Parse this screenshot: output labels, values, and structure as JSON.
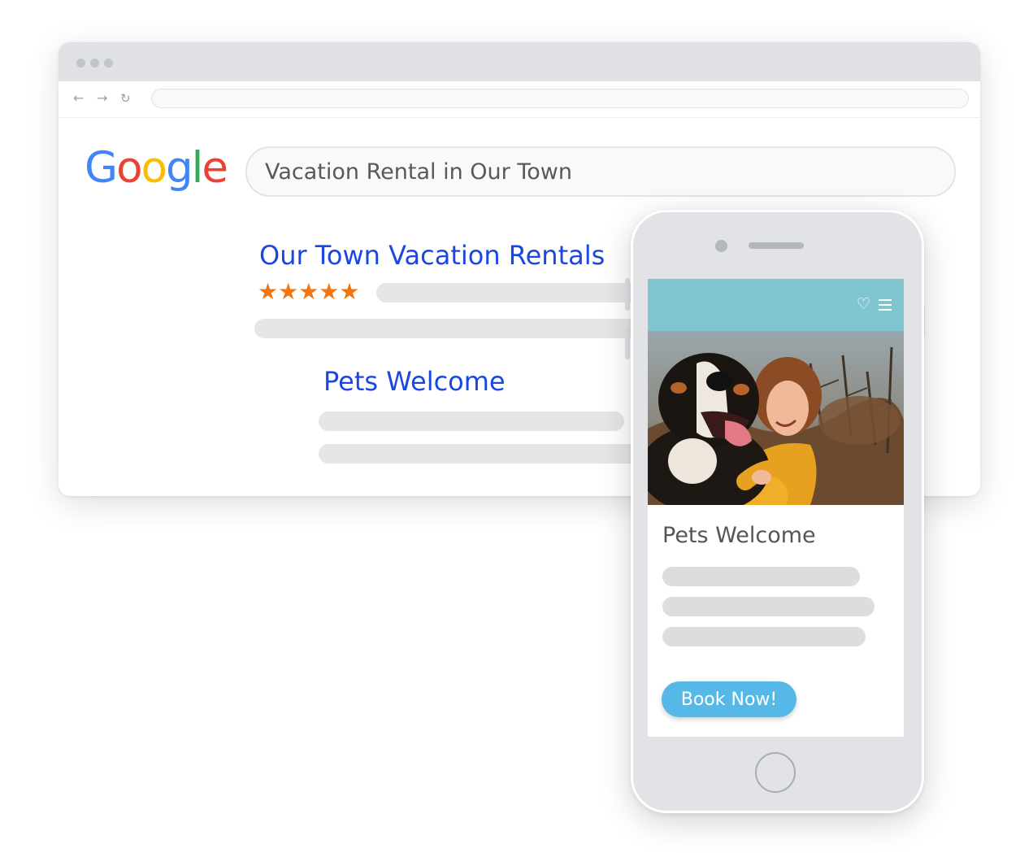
{
  "search": {
    "logo_letters": [
      "G",
      "o",
      "o",
      "g",
      "l",
      "e"
    ],
    "query": "Vacation Rental in Our Town"
  },
  "results": [
    {
      "title": "Our Town Vacation Rentals",
      "rating": 5,
      "stars": "★★★★★"
    },
    {
      "title": "Pets Welcome"
    }
  ],
  "mobile": {
    "title": "Pets Welcome",
    "book_label": "Book Now!",
    "heart_glyph": "♡"
  },
  "colors": {
    "result_link": "#1a47e0",
    "stars": "#f27510",
    "app_bar": "#7fc6d1",
    "book_button": "#56b8e6",
    "google_blue": "#4285f4",
    "google_red": "#ea4335",
    "google_yellow": "#fbbc05",
    "google_green": "#34a853"
  },
  "icons": [
    "back-arrow-icon",
    "forward-arrow-icon",
    "reload-icon",
    "heart-icon",
    "menu-icon",
    "star-icon"
  ]
}
